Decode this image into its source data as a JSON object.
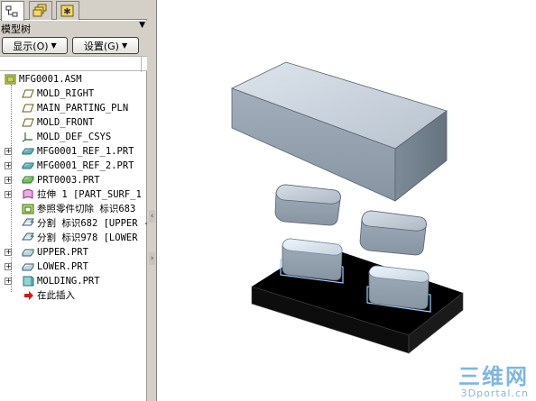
{
  "tabs": [
    {
      "name": "model-tree",
      "icon": "model-tree-icon",
      "active": true
    },
    {
      "name": "layers",
      "icon": "layers-icon",
      "active": false
    },
    {
      "name": "favorites",
      "icon": "favorites-icon",
      "active": false
    }
  ],
  "panel": {
    "title": "模型树",
    "menu_arrow": "▼",
    "display_button": "显示(O)",
    "settings_button": "设置(G)"
  },
  "tree": {
    "root": {
      "label": "MFG0001.ASM",
      "icon": "assembly-icon"
    },
    "items": [
      {
        "label": "MOLD_RIGHT",
        "icon": "datum-plane-icon",
        "expandable": false
      },
      {
        "label": "MAIN_PARTING_PLN",
        "icon": "datum-plane-icon",
        "expandable": false
      },
      {
        "label": "MOLD_FRONT",
        "icon": "datum-plane-icon",
        "expandable": false
      },
      {
        "label": "MOLD_DEF_CSYS",
        "icon": "coordinate-system-icon",
        "expandable": false
      },
      {
        "label": "MFG0001_REF_1.PRT",
        "icon": "reference-part-icon",
        "expandable": true
      },
      {
        "label": "MFG0001_REF_2.PRT",
        "icon": "reference-part-icon",
        "expandable": true
      },
      {
        "label": "PRT0003.PRT",
        "icon": "workpiece-icon",
        "expandable": true
      },
      {
        "label": "拉伸 1 [PART_SURF_1 -",
        "icon": "extrude-surface-icon",
        "expandable": true
      },
      {
        "label": "参照零件切除 标识683",
        "icon": "ref-part-cutout-icon",
        "expandable": false
      },
      {
        "label": "分割 标识682 [UPPER -",
        "icon": "split-icon",
        "expandable": false
      },
      {
        "label": "分割 标识978 [LOWER",
        "icon": "split-icon",
        "expandable": false
      },
      {
        "label": "UPPER.PRT",
        "icon": "mold-volume-part-icon",
        "expandable": true
      },
      {
        "label": "LOWER.PRT",
        "icon": "mold-volume-part-icon",
        "expandable": true
      },
      {
        "label": "MOLDING.PRT",
        "icon": "molding-part-icon",
        "expandable": true
      },
      {
        "label": "在此插入",
        "icon": "insert-here-arrow-icon",
        "expandable": false
      }
    ]
  },
  "splitter": {
    "collapse_glyph": "‹",
    "expand_glyph": "›"
  },
  "watermark": {
    "main": "三维网",
    "sub": "3Dportal.cn"
  },
  "colors": {
    "panel_bg": "#d4d0c8",
    "part_face_top": "#c8d2dc",
    "part_face_front": "#8b98a6",
    "part_face_side": "#6c7a88",
    "plate_black": "#000000",
    "highlight_edge": "#9ecbff",
    "watermark": "#7fb6e3"
  }
}
